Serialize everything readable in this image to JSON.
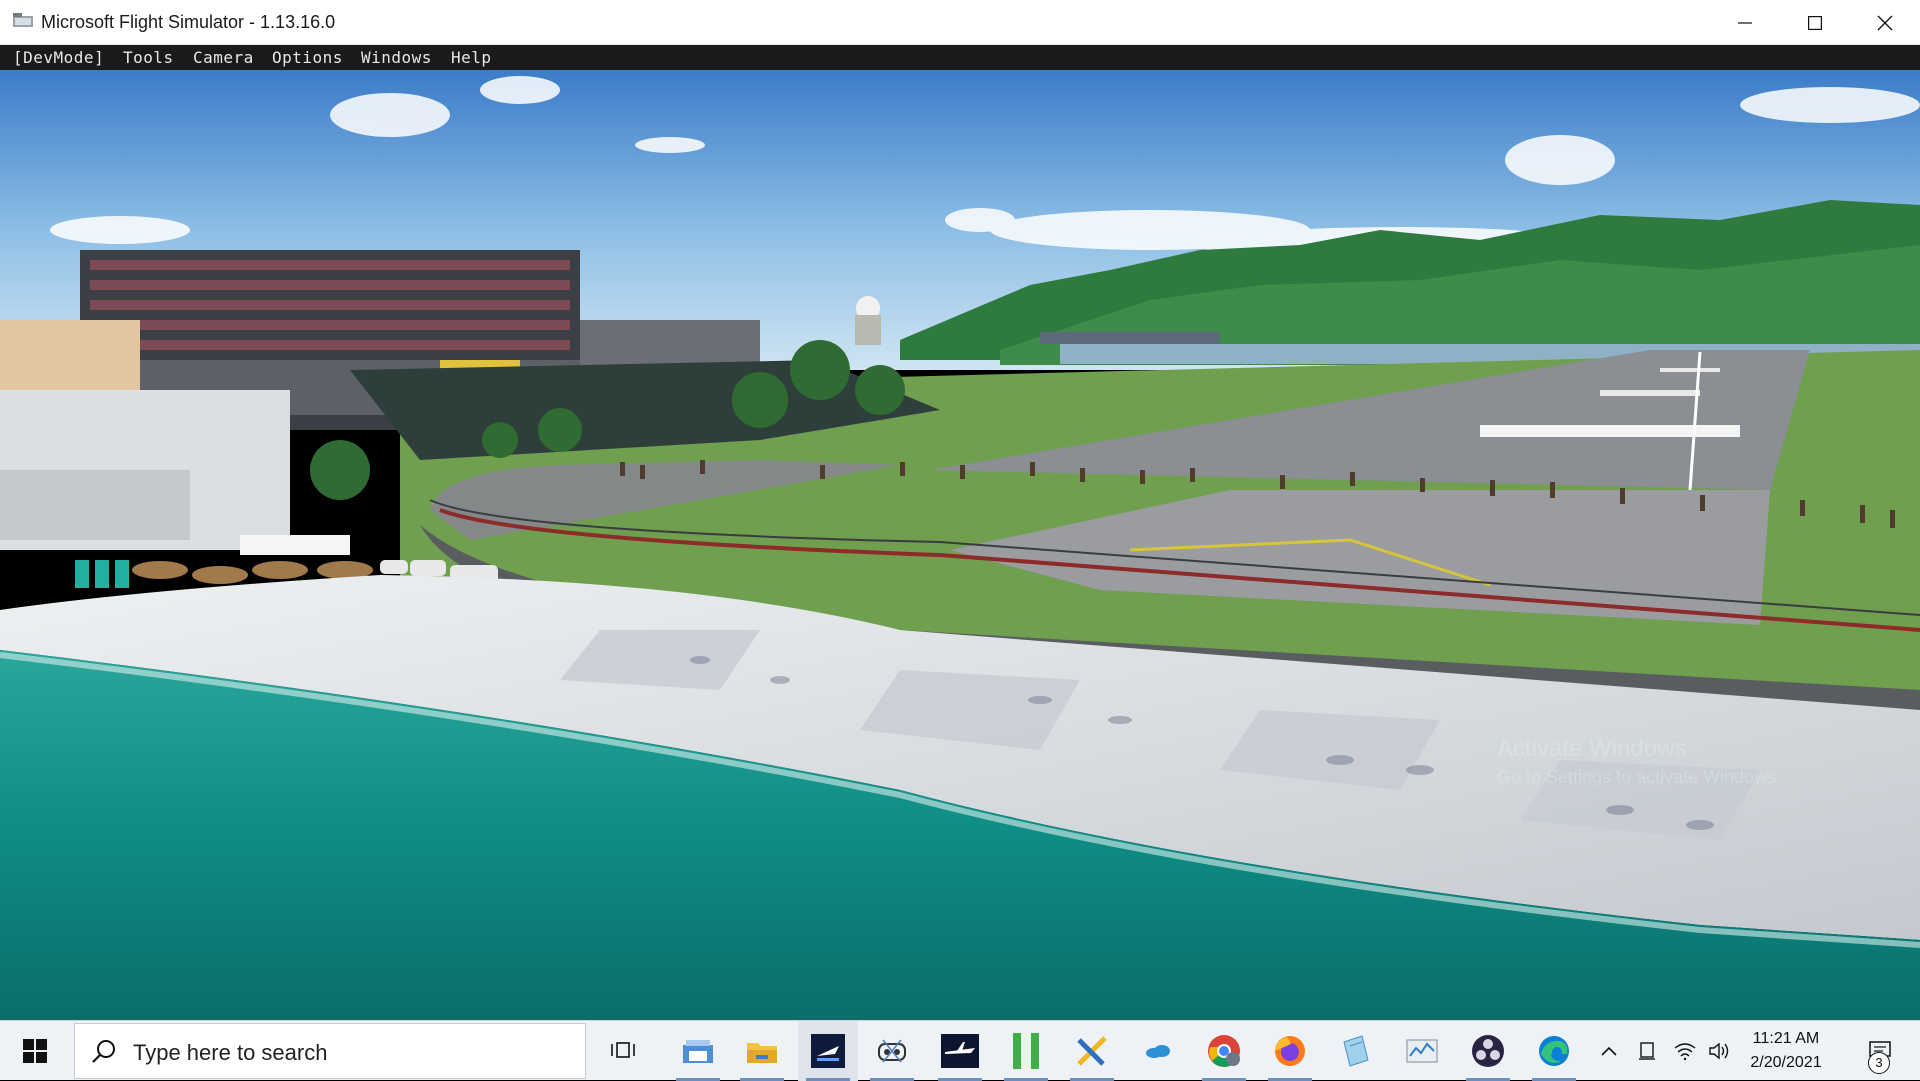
{
  "window": {
    "title": "Microsoft Flight Simulator - 1.13.16.0",
    "controls": [
      "minimize",
      "maximize",
      "close"
    ]
  },
  "menubar": {
    "items": [
      "[DevMode]",
      "Tools",
      "Camera",
      "Options",
      "Windows",
      "Help"
    ]
  },
  "scene": {
    "description_icon": "flight-sim-3d-view",
    "watermark": {
      "line1": "Activate Windows",
      "line2": "Go to Settings to activate Windows."
    }
  },
  "taskbar": {
    "search_placeholder": "Type here to search",
    "pinned": [
      "task-view-icon",
      "photos-icon",
      "file-explorer-icon",
      "flight-simulator-icon",
      "controller-app-icon",
      "aircraft-app-icon",
      "green-app-icon",
      "tools-app-icon",
      "cloud-app-icon",
      "chrome-icon",
      "firefox-icon",
      "notepad-icon",
      "performance-monitor-icon",
      "obs-icon",
      "edge-icon"
    ],
    "clock": {
      "time": "11:21 AM",
      "date": "2/20/2021"
    },
    "notifications_count": "3"
  },
  "colors": {
    "sky_top": "#3d7fcb",
    "sky_horizon": "#bcd9ef",
    "sea": "#0f8d86",
    "grass": "#6f9f4f",
    "runway": "#8a8d92",
    "taskbar": "#eef1f6",
    "menubar": "#1a1a1a"
  }
}
